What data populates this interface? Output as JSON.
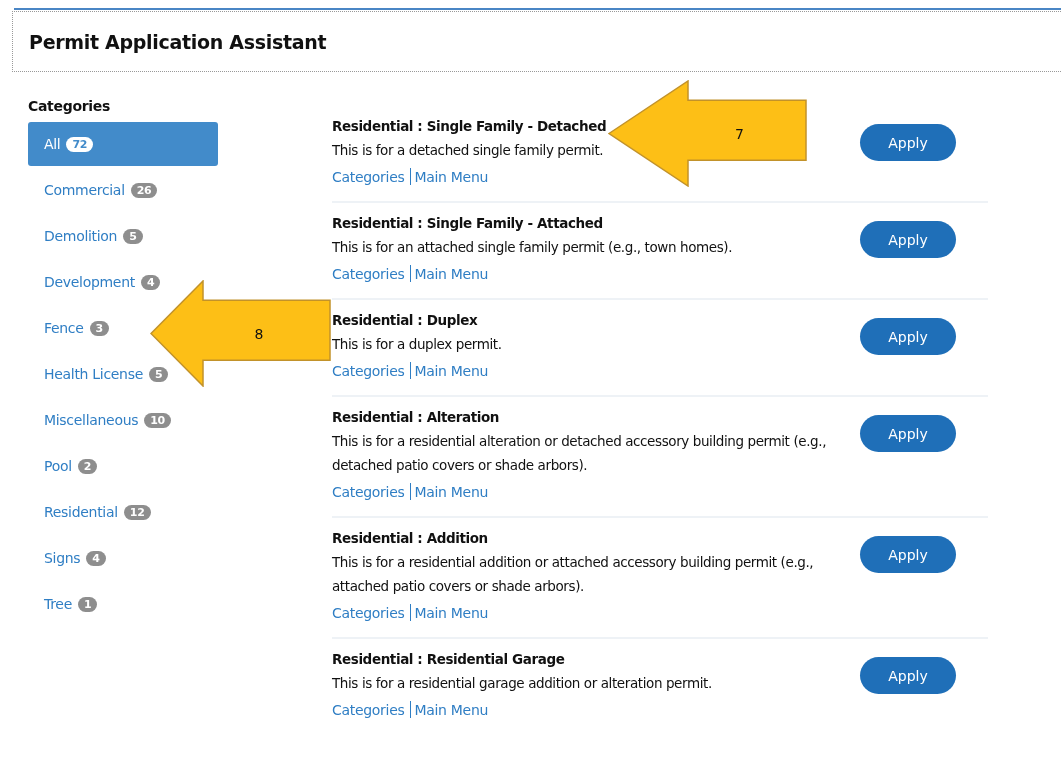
{
  "header": {
    "title": "Permit Application Assistant"
  },
  "sidebar": {
    "heading": "Categories",
    "items": [
      {
        "label": "All",
        "count": "72",
        "selected": true
      },
      {
        "label": "Commercial",
        "count": "26",
        "selected": false
      },
      {
        "label": "Demolition",
        "count": "5",
        "selected": false
      },
      {
        "label": "Development",
        "count": "4",
        "selected": false
      },
      {
        "label": "Fence",
        "count": "3",
        "selected": false
      },
      {
        "label": "Health License",
        "count": "5",
        "selected": false
      },
      {
        "label": "Miscellaneous",
        "count": "10",
        "selected": false
      },
      {
        "label": "Pool",
        "count": "2",
        "selected": false
      },
      {
        "label": "Residential",
        "count": "12",
        "selected": false
      },
      {
        "label": "Signs",
        "count": "4",
        "selected": false
      },
      {
        "label": "Tree",
        "count": "1",
        "selected": false
      }
    ]
  },
  "permits": [
    {
      "title": "Residential : Single Family - Detached",
      "description": "This is for a detached single family permit.",
      "links": [
        "Categories",
        "Main Menu"
      ],
      "button": "Apply"
    },
    {
      "title": "Residential : Single Family - Attached",
      "description": "This is for an attached single family permit (e.g., town homes).",
      "links": [
        "Categories",
        "Main Menu"
      ],
      "button": "Apply"
    },
    {
      "title": "Residential : Duplex",
      "description": "This is for a duplex permit.",
      "links": [
        "Categories",
        "Main Menu"
      ],
      "button": "Apply"
    },
    {
      "title": "Residential : Alteration",
      "description": "This is for a residential alteration or detached accessory building permit (e.g., detached patio covers or shade arbors).",
      "links": [
        "Categories",
        "Main Menu"
      ],
      "button": "Apply"
    },
    {
      "title": "Residential : Addition",
      "description": "This is for a residential addition or attached accessory building permit (e.g., attached patio covers or shade arbors).",
      "links": [
        "Categories",
        "Main Menu"
      ],
      "button": "Apply"
    },
    {
      "title": "Residential : Residential Garage",
      "description": "This is for a residential garage addition or alteration permit.",
      "links": [
        "Categories",
        "Main Menu"
      ],
      "button": "Apply"
    }
  ],
  "callouts": [
    {
      "label": "7"
    },
    {
      "label": "8"
    }
  ]
}
